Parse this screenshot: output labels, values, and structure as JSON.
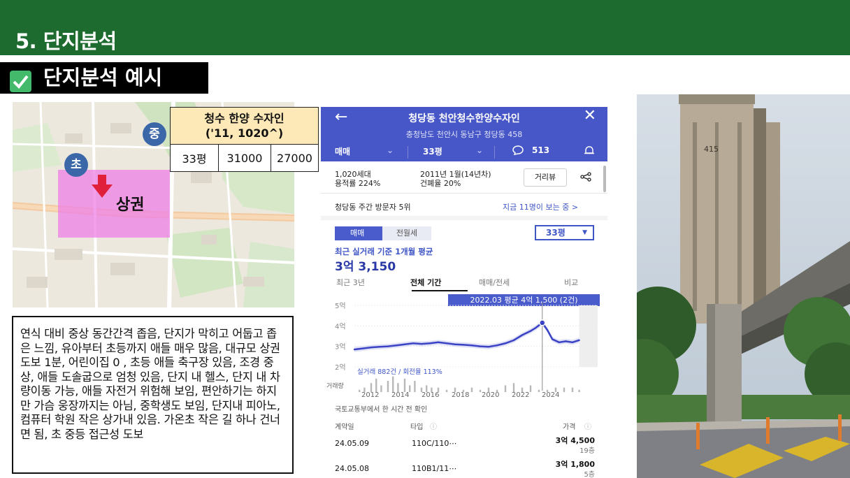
{
  "header": {
    "title": "5. 단지분석"
  },
  "subtitle": {
    "label": "단지분석 예시"
  },
  "map": {
    "markers": [
      {
        "id": "middle",
        "label": "중"
      },
      {
        "id": "elementary",
        "label": "초"
      }
    ],
    "zone_label": "상권"
  },
  "info_table": {
    "title_line1": "청수 한양 수자인",
    "title_line2": "('11, 1020^)",
    "row": [
      "33평",
      "31000",
      "27000"
    ]
  },
  "description": "연식 대비 중상 동간간격 좁음, 단지가 막히고 어둡고 좁은 느낌, 유아부터 초등까지 애들 매우 많음, 대규모 상권 도보 1분, 어린이집 0 , 초등 애들 축구장 있음, 조경 중상, 애들 도솔굽으로 엄청 있음, 단지 내 헬스, 단지 내 차량이동 가능, 애들 자전거 위험해 보임, 편안하기는 하지만 가슴 웅장까지는 아님, 중학생도 보임, 단지내 피아노, 컴퓨터 학원 작은 상가내 있음. 가온초 작은 길 하나 건너면 됨, 초 중등 접근성 도보",
  "phone": {
    "back_icon": "←",
    "close_icon": "✕",
    "title": "청당동 천안청수한양수자인",
    "address": "충청남도 천안시 동남구 청당동 458",
    "tabs": {
      "deal": "매매",
      "size": "33평",
      "comments": "513"
    },
    "summary": {
      "households": "1,020세대",
      "far": "용적률 224%",
      "built": "2011년 1월(14년차)",
      "bcr": "건폐율 20%",
      "street_view": "거리뷰"
    },
    "visitors": {
      "rank": "청당동 주간 방문자 5위",
      "watching": "지금 11명이 보는 중 >"
    },
    "chart_tabs": {
      "sale": "매매",
      "rent": "전월세",
      "size_select": "33평"
    },
    "avg_label": "최근 실거래 기준 1개월 평균",
    "avg_price": "3억 3,150",
    "period_tabs": [
      "최근 3년",
      "전체 기간",
      "매매/전세",
      "비교"
    ],
    "tooltip": "2022.03 평균 4억 1,500 (2건)",
    "trade_info": "실거래 882건 / 회전율 113%",
    "volume_label": "거래량",
    "source": "국토교통부에서 한 시간 전 확인",
    "list_headers": {
      "date": "계약일",
      "type": "타입",
      "price": "가격"
    },
    "deals": [
      {
        "date": "24.05.09",
        "type": "110C/110⋯",
        "price": "3억 4,500",
        "floor": "19층"
      },
      {
        "date": "24.05.08",
        "type": "110B1/11⋯",
        "price": "3억 1,800",
        "floor": "5층"
      }
    ]
  },
  "chart_data": {
    "type": "line",
    "title": "",
    "xlabel": "",
    "ylabel": "",
    "y_ticks": [
      "5억",
      "4억",
      "3억",
      "2억"
    ],
    "x_ticks": [
      "2012",
      "2014",
      "2016",
      "2018",
      "2020",
      "2022",
      "2024"
    ],
    "ylim": [
      2,
      5
    ],
    "xlim": [
      2011.0,
      2025.5
    ],
    "highlight": {
      "x": 2022.2,
      "y": 4.15
    },
    "series": [
      {
        "values": [
          {
            "x": 2011.0,
            "y": 2.85
          },
          {
            "x": 2011.5,
            "y": 2.9
          },
          {
            "x": 2012.0,
            "y": 2.95
          },
          {
            "x": 2012.5,
            "y": 2.98
          },
          {
            "x": 2013.0,
            "y": 3.0
          },
          {
            "x": 2013.5,
            "y": 3.05
          },
          {
            "x": 2014.0,
            "y": 3.1
          },
          {
            "x": 2014.5,
            "y": 3.15
          },
          {
            "x": 2015.0,
            "y": 3.12
          },
          {
            "x": 2015.5,
            "y": 3.15
          },
          {
            "x": 2016.0,
            "y": 3.2
          },
          {
            "x": 2016.5,
            "y": 3.15
          },
          {
            "x": 2017.0,
            "y": 3.1
          },
          {
            "x": 2017.5,
            "y": 3.08
          },
          {
            "x": 2018.0,
            "y": 3.05
          },
          {
            "x": 2018.5,
            "y": 3.0
          },
          {
            "x": 2019.0,
            "y": 2.98
          },
          {
            "x": 2019.5,
            "y": 3.05
          },
          {
            "x": 2020.0,
            "y": 3.15
          },
          {
            "x": 2020.5,
            "y": 3.3
          },
          {
            "x": 2021.0,
            "y": 3.55
          },
          {
            "x": 2021.5,
            "y": 3.75
          },
          {
            "x": 2021.8,
            "y": 3.9
          },
          {
            "x": 2022.2,
            "y": 4.15
          },
          {
            "x": 2022.5,
            "y": 3.8
          },
          {
            "x": 2022.8,
            "y": 3.35
          },
          {
            "x": 2023.2,
            "y": 3.2
          },
          {
            "x": 2023.6,
            "y": 3.25
          },
          {
            "x": 2024.0,
            "y": 3.2
          },
          {
            "x": 2024.4,
            "y": 3.3
          }
        ]
      }
    ],
    "volume": [
      {
        "x": 2011.3,
        "v": 1
      },
      {
        "x": 2011.6,
        "v": 2
      },
      {
        "x": 2012.0,
        "v": 4
      },
      {
        "x": 2012.3,
        "v": 6
      },
      {
        "x": 2012.6,
        "v": 3
      },
      {
        "x": 2013.0,
        "v": 5
      },
      {
        "x": 2013.3,
        "v": 7
      },
      {
        "x": 2013.6,
        "v": 4
      },
      {
        "x": 2014.0,
        "v": 6
      },
      {
        "x": 2014.3,
        "v": 3
      },
      {
        "x": 2014.6,
        "v": 5
      },
      {
        "x": 2015.0,
        "v": 2
      },
      {
        "x": 2015.3,
        "v": 3
      },
      {
        "x": 2015.6,
        "v": 2
      },
      {
        "x": 2016.0,
        "v": 2
      },
      {
        "x": 2016.5,
        "v": 1
      },
      {
        "x": 2017.0,
        "v": 2
      },
      {
        "x": 2017.5,
        "v": 1
      },
      {
        "x": 2018.0,
        "v": 2
      },
      {
        "x": 2018.5,
        "v": 1
      },
      {
        "x": 2019.0,
        "v": 2
      },
      {
        "x": 2019.5,
        "v": 1
      },
      {
        "x": 2020.0,
        "v": 3
      },
      {
        "x": 2020.5,
        "v": 4
      },
      {
        "x": 2021.0,
        "v": 2
      },
      {
        "x": 2021.5,
        "v": 3
      },
      {
        "x": 2022.0,
        "v": 1
      },
      {
        "x": 2022.5,
        "v": 1
      },
      {
        "x": 2023.0,
        "v": 2
      },
      {
        "x": 2023.5,
        "v": 2
      },
      {
        "x": 2024.0,
        "v": 2
      },
      {
        "x": 2024.4,
        "v": 1
      }
    ]
  }
}
